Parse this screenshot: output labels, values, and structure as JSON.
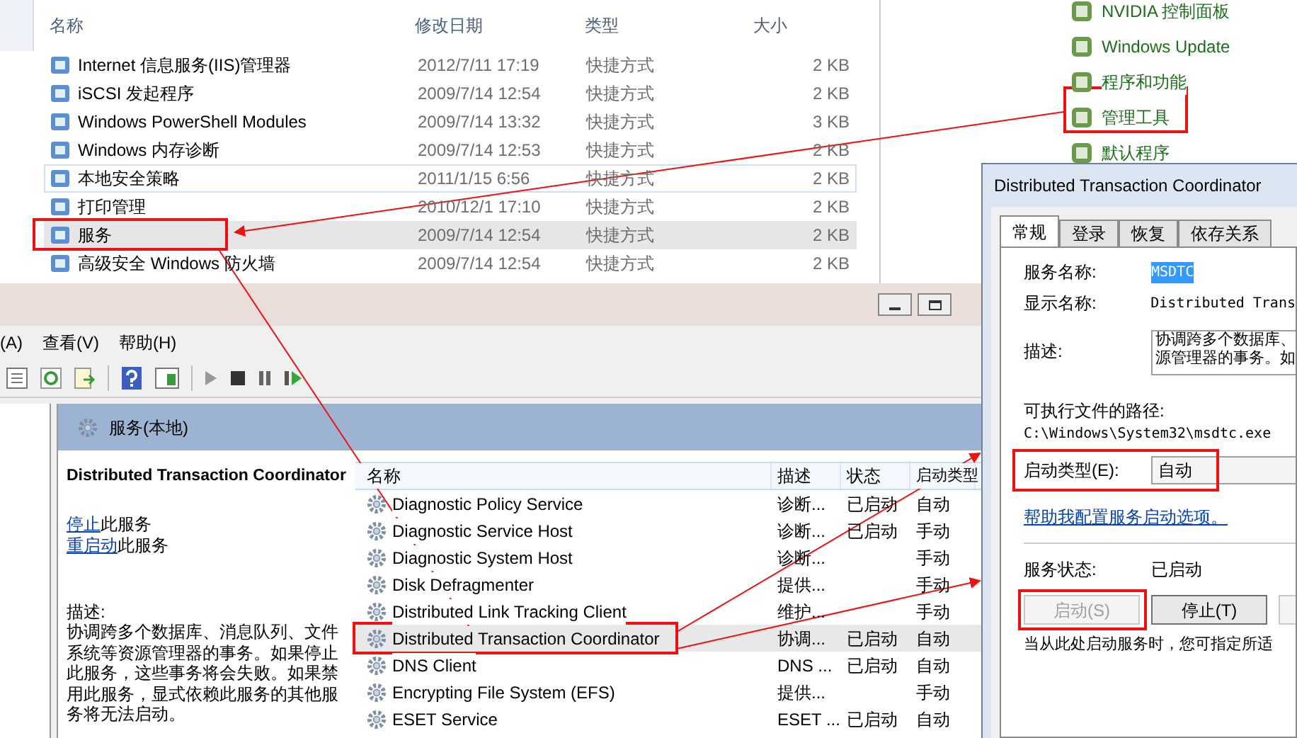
{
  "explorer": {
    "columns": [
      "名称",
      "修改日期",
      "类型",
      "大小"
    ],
    "rows": [
      {
        "name": "Internet 信息服务(IIS)管理器",
        "date": "2012/7/11 17:19",
        "type": "快捷方式",
        "size": "2 KB",
        "selected": false,
        "hovered": false
      },
      {
        "name": "iSCSI 发起程序",
        "date": "2009/7/14 12:54",
        "type": "快捷方式",
        "size": "2 KB",
        "selected": false,
        "hovered": false
      },
      {
        "name": "Windows PowerShell Modules",
        "date": "2009/7/14 13:32",
        "type": "快捷方式",
        "size": "3 KB",
        "selected": false,
        "hovered": false
      },
      {
        "name": "Windows 内存诊断",
        "date": "2009/7/14 12:53",
        "type": "快捷方式",
        "size": "2 KB",
        "selected": false,
        "hovered": false
      },
      {
        "name": "本地安全策略",
        "date": "2011/1/15 6:56",
        "type": "快捷方式",
        "size": "2 KB",
        "selected": false,
        "hovered": true
      },
      {
        "name": "打印管理",
        "date": "2010/12/1 17:10",
        "type": "快捷方式",
        "size": "2 KB",
        "selected": false,
        "hovered": false
      },
      {
        "name": "服务",
        "date": "2009/7/14 12:54",
        "type": "快捷方式",
        "size": "2 KB",
        "selected": true,
        "hovered": false
      },
      {
        "name": "高级安全 Windows 防火墙",
        "date": "2009/7/14 12:54",
        "type": "快捷方式",
        "size": "2 KB",
        "selected": false,
        "hovered": false
      }
    ]
  },
  "control_panel": {
    "items": [
      "NVIDIA 控制面板",
      "Windows Update",
      "程序和功能",
      "管理工具",
      "默认程序"
    ]
  },
  "services_window": {
    "menu": [
      "(A)",
      "查看(V)",
      "帮助(H)"
    ],
    "scope_title": "服务(本地)",
    "detail": {
      "title": "Distributed Transaction Coordinator",
      "actions": [
        {
          "link": "停止",
          "rest": "此服务"
        },
        {
          "link": "重启动",
          "rest": "此服务"
        }
      ],
      "description_label": "描述:",
      "description": "协调跨多个数据库、消息队列、文件系统等资源管理器的事务。如果停止此服务，这些事务将会失败。如果禁用此服务，显式依赖此服务的其他服务将无法启动。"
    },
    "columns": [
      "名称",
      "描述",
      "状态",
      "启动类型"
    ],
    "rows": [
      {
        "name": "Diagnostic Policy Service",
        "description": "诊断...",
        "status": "已启动",
        "startup": "自动",
        "selected": false
      },
      {
        "name": "Diagnostic Service Host",
        "description": "诊断...",
        "status": "已启动",
        "startup": "手动",
        "selected": false
      },
      {
        "name": "Diagnostic System Host",
        "description": "诊断...",
        "status": "",
        "startup": "手动",
        "selected": false
      },
      {
        "name": "Disk Defragmenter",
        "description": "提供...",
        "status": "",
        "startup": "手动",
        "selected": false
      },
      {
        "name": "Distributed Link Tracking Client",
        "description": "维护...",
        "status": "",
        "startup": "手动",
        "selected": false
      },
      {
        "name": "Distributed Transaction Coordinator",
        "description": "协调...",
        "status": "已启动",
        "startup": "自动",
        "selected": true
      },
      {
        "name": "DNS Client",
        "description": "DNS ...",
        "status": "已启动",
        "startup": "自动",
        "selected": false
      },
      {
        "name": "Encrypting File System (EFS)",
        "description": "提供...",
        "status": "",
        "startup": "手动",
        "selected": false
      },
      {
        "name": "ESET Service",
        "description": "ESET ...",
        "status": "已启动",
        "startup": "自动",
        "selected": false
      }
    ]
  },
  "dialog": {
    "title": "Distributed Transaction Coordinator",
    "tabs": [
      {
        "label": "常规",
        "selected": true
      },
      {
        "label": "登录",
        "selected": false
      },
      {
        "label": "恢复",
        "selected": false
      },
      {
        "label": "依存关系",
        "selected": false
      }
    ],
    "service_name_label": "服务名称:",
    "service_name": "MSDTC",
    "display_name_label": "显示名称:",
    "display_name": "Distributed Trans",
    "description_label": "描述:",
    "description_lines": [
      "协调跨多个数据库、",
      "源管理器的事务。如"
    ],
    "path_label": "可执行文件的路径:",
    "path": "C:\\Windows\\System32\\msdtc.exe",
    "startup_type_label": "启动类型(E):",
    "startup_type": "自动",
    "help_link": "帮助我配置服务启动选项。",
    "status_label": "服务状态:",
    "status": "已启动",
    "buttons": [
      {
        "label": "启动(S)",
        "disabled": true
      },
      {
        "label": "停止(T)",
        "disabled": false
      }
    ],
    "note": "当从此处启动服务时，您可指定所适"
  }
}
